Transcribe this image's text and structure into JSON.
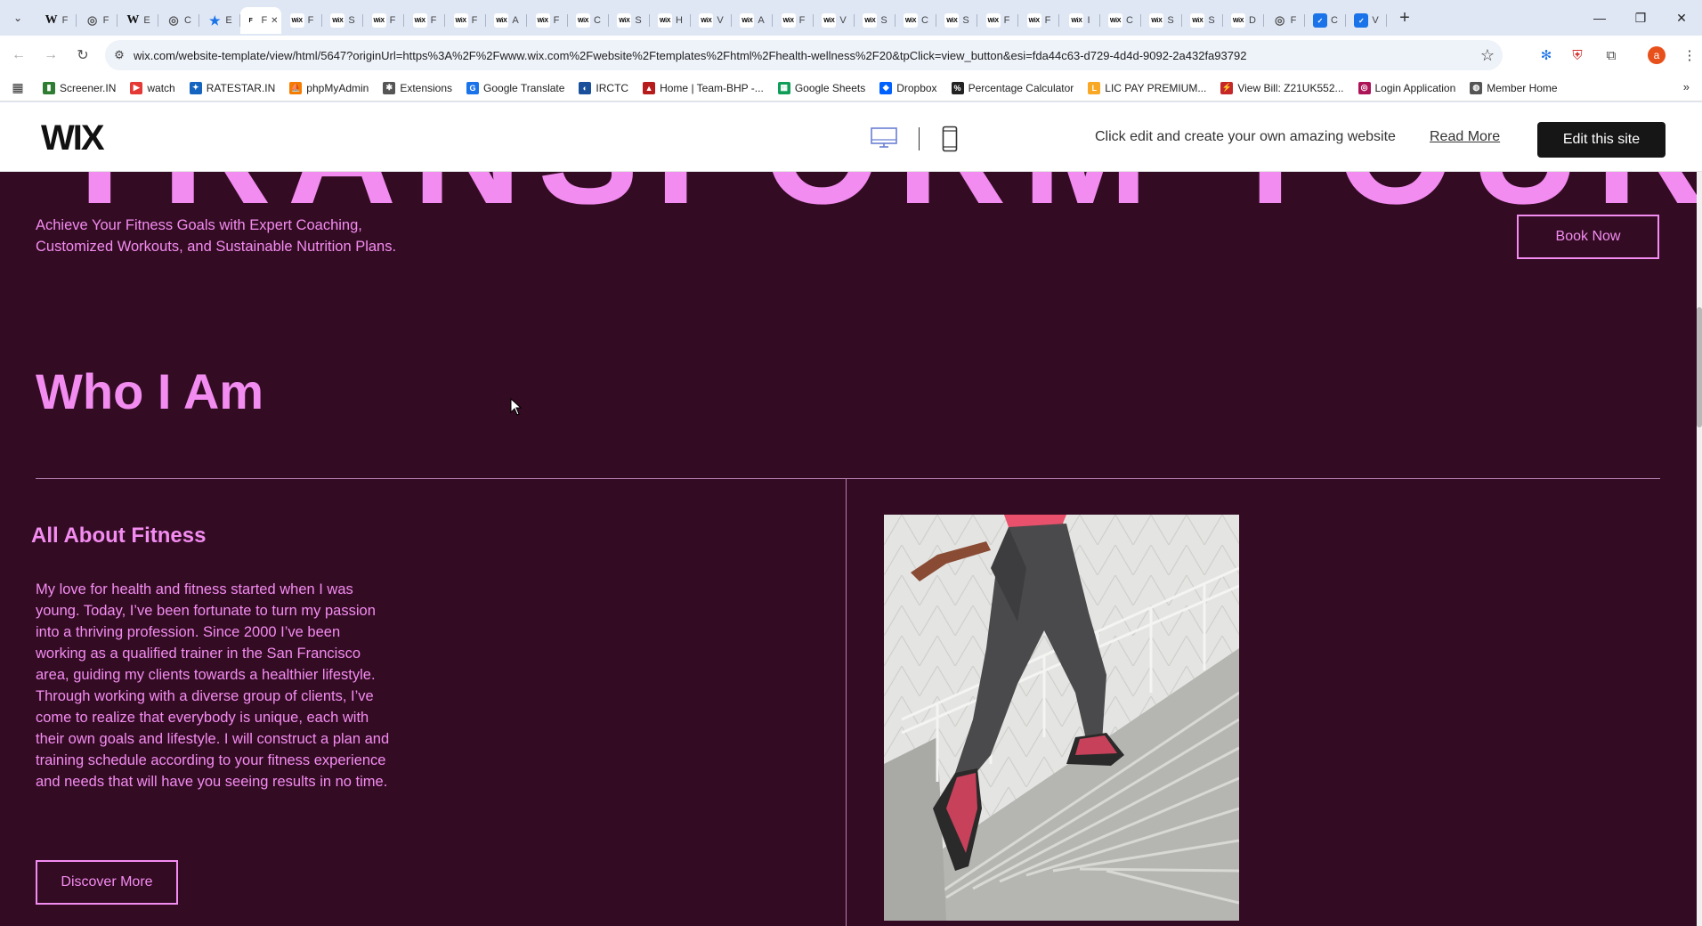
{
  "browser": {
    "tabs": [
      {
        "icon": "w",
        "letter": "F"
      },
      {
        "icon": "globe",
        "letter": "F"
      },
      {
        "icon": "w",
        "letter": "E"
      },
      {
        "icon": "globe",
        "letter": "C"
      },
      {
        "icon": "star",
        "letter": "E"
      },
      {
        "icon": "active",
        "letter": "F"
      },
      {
        "icon": "wix",
        "letter": "F"
      },
      {
        "icon": "wix",
        "letter": "S"
      },
      {
        "icon": "wix",
        "letter": "F"
      },
      {
        "icon": "wix",
        "letter": "F"
      },
      {
        "icon": "wix",
        "letter": "F"
      },
      {
        "icon": "wix",
        "letter": "A"
      },
      {
        "icon": "wix",
        "letter": "F"
      },
      {
        "icon": "wix",
        "letter": "C"
      },
      {
        "icon": "wix",
        "letter": "S"
      },
      {
        "icon": "wix",
        "letter": "H"
      },
      {
        "icon": "wix",
        "letter": "V"
      },
      {
        "icon": "wix",
        "letter": "A"
      },
      {
        "icon": "wix",
        "letter": "F"
      },
      {
        "icon": "wix",
        "letter": "V"
      },
      {
        "icon": "wix",
        "letter": "S"
      },
      {
        "icon": "wix",
        "letter": "C"
      },
      {
        "icon": "wix",
        "letter": "S"
      },
      {
        "icon": "wix",
        "letter": "F"
      },
      {
        "icon": "wix",
        "letter": "F"
      },
      {
        "icon": "wix",
        "letter": "I"
      },
      {
        "icon": "wix",
        "letter": "C"
      },
      {
        "icon": "wix",
        "letter": "S"
      },
      {
        "icon": "wix",
        "letter": "S"
      },
      {
        "icon": "wix",
        "letter": "D"
      },
      {
        "icon": "globe",
        "letter": "F"
      },
      {
        "icon": "blue",
        "letter": "C"
      },
      {
        "icon": "blue",
        "letter": "V"
      }
    ],
    "new_tab": "+",
    "url": "wix.com/website-template/view/html/5647?originUrl=https%3A%2F%2Fwww.wix.com%2Fwebsite%2Ftemplates%2Fhtml%2Fhealth-wellness%2F20&tpClick=view_button&esi=fda44c63-d729-4d4d-9092-2a432fa93792",
    "profile_initial": "a",
    "bookmarks": [
      {
        "label": "Screener.IN",
        "color": "#2e7d32",
        "glyph": "▮"
      },
      {
        "label": "watch",
        "color": "#e53935",
        "glyph": "▶"
      },
      {
        "label": "RATESTAR.IN",
        "color": "#1565c0",
        "glyph": "✦"
      },
      {
        "label": "phpMyAdmin",
        "color": "#f57c00",
        "glyph": "⛵"
      },
      {
        "label": "Extensions",
        "color": "#555555",
        "glyph": "✱"
      },
      {
        "label": "Google Translate",
        "color": "#1a73e8",
        "glyph": "G"
      },
      {
        "label": "IRCTC",
        "color": "#1a4f9c",
        "glyph": "◐"
      },
      {
        "label": "Home | Team-BHP -...",
        "color": "#b71c1c",
        "glyph": "▲"
      },
      {
        "label": "Google Sheets",
        "color": "#0f9d58",
        "glyph": "▦"
      },
      {
        "label": "Dropbox",
        "color": "#0061fe",
        "glyph": "◆"
      },
      {
        "label": "Percentage Calculator",
        "color": "#222222",
        "glyph": "%"
      },
      {
        "label": "LIC PAY PREMIUM...",
        "color": "#f9a825",
        "glyph": "L"
      },
      {
        "label": "View Bill: Z21UK552...",
        "color": "#c62828",
        "glyph": "⚡"
      },
      {
        "label": "Login Application",
        "color": "#ad1457",
        "glyph": "◎"
      },
      {
        "label": "Member Home",
        "color": "#555555",
        "glyph": "◍"
      }
    ]
  },
  "wix_bar": {
    "logo": "WIX",
    "tagline": "Click edit and create your own amazing website",
    "read_more": "Read More",
    "edit_button": "Edit this site"
  },
  "site": {
    "hero_text": "TRANSFORM YOUR BODY",
    "hero_subtitle": "Achieve Your Fitness Goals with Expert Coaching, Customized Workouts, and Sustainable Nutrition Plans.",
    "book_now": "Book Now",
    "section_title": "Who I Am",
    "subheading": "All About Fitness",
    "about_body": "My love for health and fitness started when I was young. Today, I’ve been fortunate to turn my passion into a thriving profession. Since 2000 I’ve been working as a qualified trainer in the San Francisco area, guiding my clients towards a healthier lifestyle. Through working with a diverse group of clients, I’ve come to realize that everybody is unique, each with their own goals and lifestyle. I will construct a plan and training schedule according to your fitness experience and needs that will have you seeing results in no time.",
    "discover_more": "Discover More",
    "accent_color": "#f38cf1",
    "background_color": "#330b22"
  }
}
